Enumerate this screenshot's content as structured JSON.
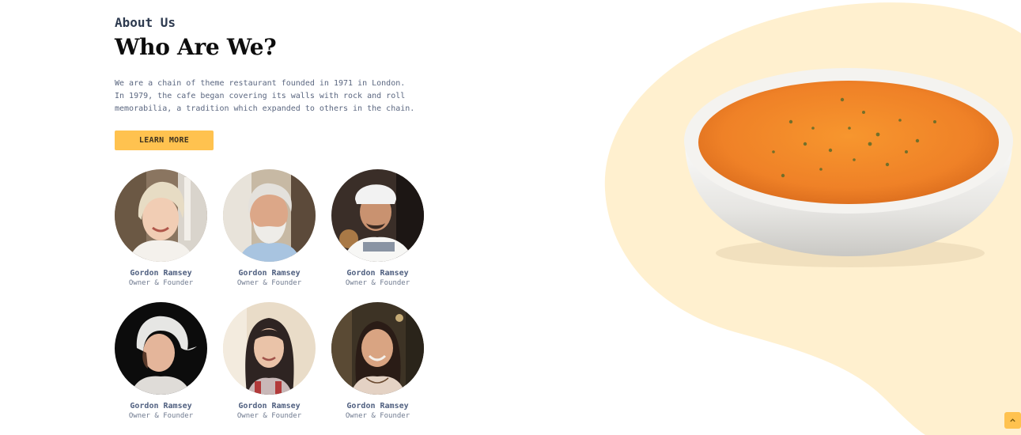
{
  "about": {
    "eyebrow": "About Us",
    "title": "Who Are We?",
    "description": "We are a chain of theme restaurant founded in 1971 in London. In 1979, the cafe began covering its walls with rock and roll memorabilia, a tradition which expanded to others in the chain.",
    "cta_label": "LEARN MORE"
  },
  "team": [
    {
      "name": "Gordon Ramsey",
      "role": "Owner & Founder"
    },
    {
      "name": "Gordon Ramsey",
      "role": "Owner & Founder"
    },
    {
      "name": "Gordon Ramsey",
      "role": "Owner & Founder"
    },
    {
      "name": "Gordon Ramsey",
      "role": "Owner & Founder"
    },
    {
      "name": "Gordon Ramsey",
      "role": "Owner & Founder"
    },
    {
      "name": "Gordon Ramsey",
      "role": "Owner & Founder"
    }
  ],
  "colors": {
    "accent": "#ffc24f",
    "blob": "#fff0cf",
    "soup": "#f08a2a",
    "heading": "#0d0d0d"
  },
  "icons": {
    "back_to_top": "chevron-up-icon"
  }
}
